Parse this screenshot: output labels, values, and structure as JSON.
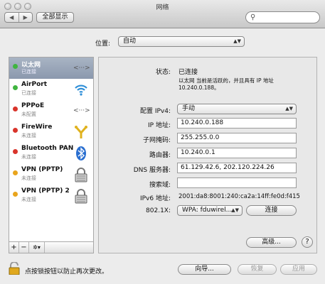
{
  "window": {
    "title": "网络"
  },
  "toolbar": {
    "back": "◀",
    "forward": "▶",
    "show_all": "全部显示",
    "search_placeholder": ""
  },
  "location": {
    "label": "位置:",
    "value": "自动"
  },
  "services": [
    {
      "name": "以太网",
      "status": "已连接",
      "dot_color": "#3fb53f",
      "icon": "ethernet-icon",
      "glyph": "‹···›",
      "selected": true
    },
    {
      "name": "AirPort",
      "status": "已连接",
      "dot_color": "#3fb53f",
      "icon": "wifi-icon",
      "glyph": "((•))",
      "selected": false
    },
    {
      "name": "PPPoE",
      "status": "未配置",
      "dot_color": "#d9342b",
      "icon": "pppoe-icon",
      "glyph": "‹···›",
      "selected": false
    },
    {
      "name": "FireWire",
      "status": "未连接",
      "dot_color": "#d9342b",
      "icon": "firewire-icon",
      "glyph": "Y",
      "selected": false
    },
    {
      "name": "Bluetooth PAN",
      "status": "未连接",
      "dot_color": "#d9342b",
      "icon": "bluetooth-icon",
      "glyph": "ᛒ",
      "selected": false
    },
    {
      "name": "VPN (PPTP)",
      "status": "未连接",
      "dot_color": "#e9a51d",
      "icon": "lock-icon",
      "glyph": "🔒",
      "selected": false
    },
    {
      "name": "VPN (PPTP) 2",
      "status": "未连接",
      "dot_color": "#e9a51d",
      "icon": "lock-icon",
      "glyph": "🔒",
      "selected": false
    }
  ],
  "sidebar_bottom": {
    "add": "+",
    "remove": "−",
    "gear": "✲▾"
  },
  "detail": {
    "status_label": "状态:",
    "status_value": "已连接",
    "status_desc_1": "以太网 当前是活跃的，并且具有 IP 地址",
    "status_desc_2": "10.240.0.188。",
    "configure_label": "配置 IPv4:",
    "configure_value": "手动",
    "ip_label": "IP 地址:",
    "ip_value": "10.240.0.188",
    "subnet_label": "子网掩码:",
    "subnet_value": "255.255.0.0",
    "router_label": "路由器:",
    "router_value": "10.240.0.1",
    "dns_label": "DNS 服务器:",
    "dns_value": "61.129.42.6, 202.120.224.26",
    "search_domain_label": "搜索域:",
    "search_domain_value": "",
    "ipv6_label": "IPv6 地址:",
    "ipv6_value": "2001:da8:8001:240:ca2a:14ff:fe0d:f415",
    "x8021_label": "802.1X:",
    "x8021_value": "WPA: fduwirel...",
    "connect_button": "连接",
    "advanced_button": "高级...",
    "help": "?"
  },
  "footer": {
    "lock_text": "点按锁按钮以防止再次更改。",
    "assist_button": "向导...",
    "revert_button": "恢复",
    "apply_button": "应用"
  }
}
